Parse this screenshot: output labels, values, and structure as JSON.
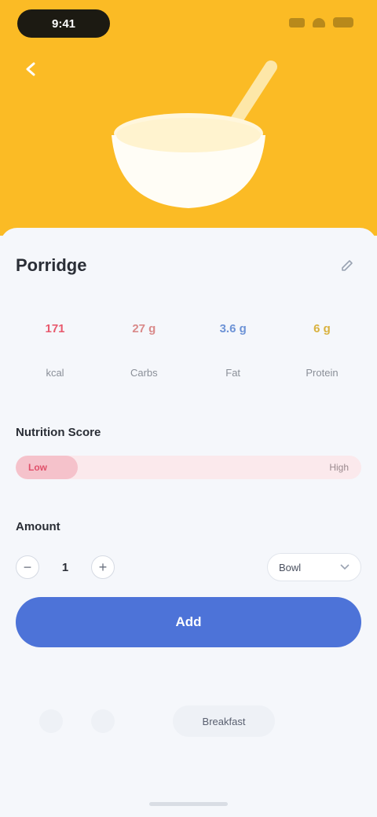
{
  "status_bar": {
    "time": "9:41"
  },
  "food": {
    "name": "Porridge"
  },
  "nutrients": [
    {
      "value": "171",
      "label": "kcal",
      "color": "#e85a6e"
    },
    {
      "value": "27 g",
      "label": "Carbs",
      "color": "#f2a7a7"
    },
    {
      "value": "3.6 g",
      "label": "Fat",
      "color": "#a9c4f2"
    },
    {
      "value": "6 g",
      "label": "Protein",
      "color": "#f6dc8c"
    }
  ],
  "health_score": {
    "label": "Nutrition Score",
    "low_text": "Low",
    "high_text": "High",
    "value": 0.18
  },
  "amount": {
    "label": "Amount",
    "quantity": "1",
    "minus": "−",
    "plus": "+",
    "unit": "Bowl"
  },
  "add_button": {
    "label": "Add"
  },
  "meal": {
    "pill_label": "Breakfast"
  },
  "colors": {
    "hero": "#fbbb25",
    "accent": "#4d73d8"
  },
  "icons": {
    "back": "arrow-left-icon",
    "edit": "edit-icon",
    "bowl": "bowl-spoon-icon"
  }
}
